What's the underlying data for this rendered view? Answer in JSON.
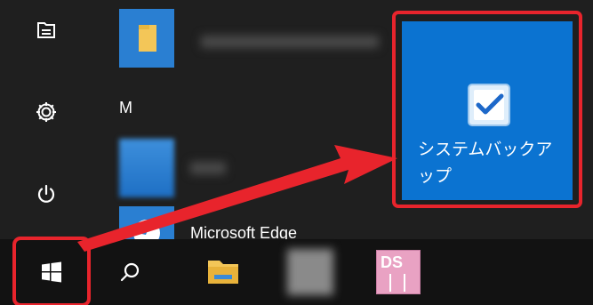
{
  "start_menu": {
    "section_letter": "M",
    "edge_label": "Microsoft Edge",
    "sidebar": [
      {
        "icon": "pictures-icon"
      },
      {
        "icon": "settings-icon"
      },
      {
        "icon": "power-icon"
      }
    ],
    "tile": {
      "label": "システムバックアップ",
      "icon": "system-backup-icon",
      "color": "#0b73d1"
    }
  },
  "taskbar": {
    "items": [
      {
        "icon": "windows-start-icon"
      },
      {
        "icon": "search-icon"
      },
      {
        "icon": "file-explorer-icon"
      },
      {
        "icon": "blurred-app-icon"
      },
      {
        "icon": "ds-app-icon",
        "text": "DS"
      }
    ]
  },
  "annotation": {
    "color": "#e8242c"
  }
}
